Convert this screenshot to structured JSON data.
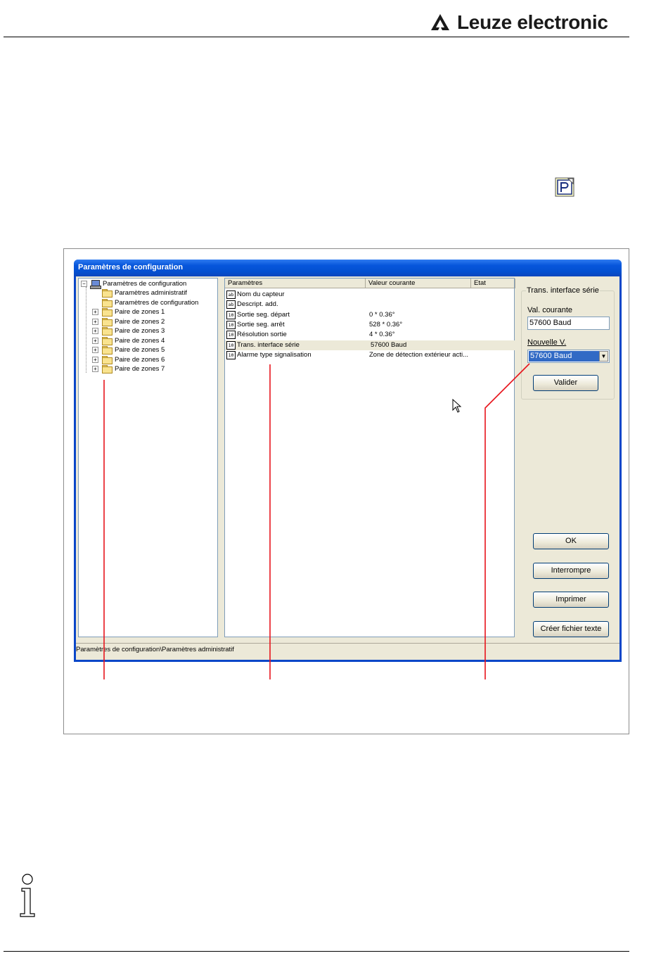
{
  "header": {
    "brand": "Leuze electronic"
  },
  "dialog": {
    "title": "Paramètres de configuration",
    "tree": {
      "root": "Paramètres de configuration",
      "items": [
        "Paramètres administratif",
        "Paramètres de configuration",
        "Paire de zones 1",
        "Paire de zones 2",
        "Paire de zones 3",
        "Paire de zones 4",
        "Paire de zones 5",
        "Paire de zones 6",
        "Paire de zones 7"
      ]
    },
    "list": {
      "columns": [
        "Paramètres",
        "Valeur courante",
        "Etat"
      ],
      "rows": [
        {
          "icon": "ab",
          "name": "Nom du capteur",
          "value": ""
        },
        {
          "icon": "ab",
          "name": "Descript. add.",
          "value": ""
        },
        {
          "icon": "10",
          "name": "Sortie seg. départ",
          "value": "0 * 0.36°"
        },
        {
          "icon": "10",
          "name": "Sortie seg. arrêt",
          "value": "528 * 0.36°"
        },
        {
          "icon": "10",
          "name": "Résolution sortie",
          "value": "4 * 0.36°"
        },
        {
          "icon": "10",
          "name": "Trans. interface série",
          "value": "57600 Baud"
        },
        {
          "icon": "10",
          "name": "Alarme type signalisation",
          "value": "Zone de détection extérieur acti..."
        }
      ]
    },
    "panel": {
      "group_title": "Trans. interface série",
      "current_label": "Val. courante",
      "current_value": "57600 Baud",
      "new_label": "Nouvelle V.",
      "new_value": "57600 Baud",
      "validate_button": "Valider",
      "ok_button": "OK",
      "cancel_button": "Interrompre",
      "print_button": "Imprimer",
      "export_button": "Créer fichier texte"
    },
    "status_bar": "Paramètres de configuration\\Paramètres administratif"
  },
  "colors": {
    "titlebar": "#0756db",
    "window_bg": "#ece9d8",
    "selection": "#316ac5",
    "callout": "#e8141c"
  }
}
